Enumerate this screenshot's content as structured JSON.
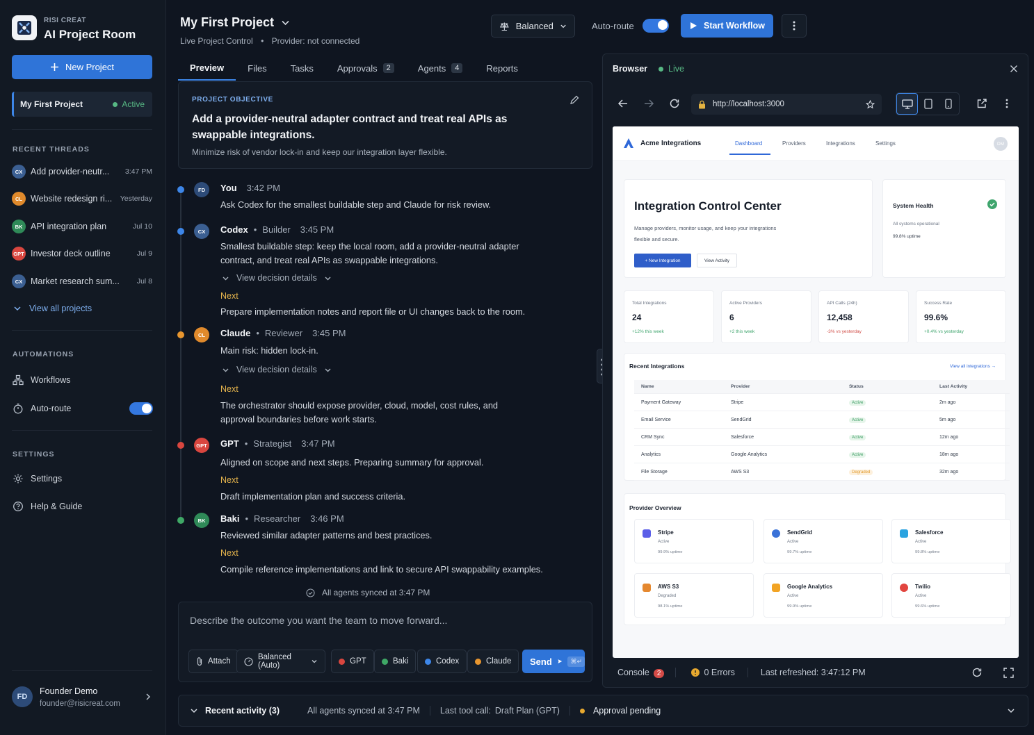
{
  "sidebar": {
    "brand_small": "RISI CREAT",
    "brand_title": "AI Project Room",
    "new_project_label": "New Project",
    "current_project": {
      "name": "My First Project",
      "status": "Active"
    },
    "recent_threads_heading": "RECENT THREADS",
    "threads": [
      {
        "avatar": "CX",
        "title": "Add provider-neutr...",
        "time": "3:47 PM",
        "color": "#3b5f92"
      },
      {
        "avatar": "CL",
        "title": "Website redesign ri...",
        "time": "Yesterday",
        "color": "#e08a2c"
      },
      {
        "avatar": "BK",
        "title": "API integration plan",
        "time": "Jul 10",
        "color": "#2f8a58"
      },
      {
        "avatar": "GPT",
        "title": "Investor deck outline",
        "time": "Jul 9",
        "color": "#d9463f"
      },
      {
        "avatar": "CX",
        "title": "Market research sum...",
        "time": "Jul 8",
        "color": "#3b5f92"
      }
    ],
    "view_all_label": "View all projects",
    "automations_heading": "AUTOMATIONS",
    "workflows_label": "Workflows",
    "auto_route_label": "Auto-route",
    "settings_heading": "SETTINGS",
    "settings_label": "Settings",
    "help_label": "Help & Guide",
    "user": {
      "initials": "FD",
      "name": "Founder Demo",
      "email": "founder@risicreat.com"
    }
  },
  "header": {
    "project_title": "My First Project",
    "subtitle": "Live Project Control",
    "provider_status": "Provider: not connected",
    "mode_label": "Balanced",
    "auto_route_label": "Auto-route",
    "start_label": "Start Workflow"
  },
  "tabs": [
    {
      "label": "Preview",
      "badge": ""
    },
    {
      "label": "Files",
      "badge": ""
    },
    {
      "label": "Tasks",
      "badge": ""
    },
    {
      "label": "Approvals",
      "badge": "2"
    },
    {
      "label": "Agents",
      "badge": "4"
    },
    {
      "label": "Reports",
      "badge": ""
    }
  ],
  "objective": {
    "heading": "PROJECT OBJECTIVE",
    "title": "Add a provider-neutral adapter contract and treat real APIs as swappable integrations.",
    "description": "Minimize risk of vendor lock-in and keep our integration layer flexible."
  },
  "messages": [
    {
      "avatar": "FD",
      "name": "You",
      "role": "",
      "time": "3:42 PM",
      "body": "Ask Codex for the smallest buildable step and Claude for risk review.",
      "dot": "#3d86e8",
      "avcolor": "#2d4b78"
    },
    {
      "avatar": "CX",
      "name": "Codex",
      "role": "Builder",
      "time": "3:45 PM",
      "body": "Smallest buildable step: keep the local room, add a provider-neutral adapter contract, and treat real APIs as swappable integrations.",
      "details": "View decision details",
      "next_label": "Next",
      "next": "Prepare implementation notes and report file or UI changes back to the room.",
      "dot": "#3d86e8",
      "avcolor": "#3b5f92"
    },
    {
      "avatar": "CL",
      "name": "Claude",
      "role": "Reviewer",
      "time": "3:45 PM",
      "body": "Main risk: hidden lock-in.",
      "details": "View decision details",
      "next_label": "Next",
      "next": "The orchestrator should expose provider, cloud, model, cost rules, and approval boundaries before work starts.",
      "dot": "#e8962f",
      "avcolor": "#e08a2c"
    },
    {
      "avatar": "GPT",
      "name": "GPT",
      "role": "Strategist",
      "time": "3:47 PM",
      "body": "Aligned on scope and next steps. Preparing summary for approval.",
      "next_label": "Next",
      "next": "Draft implementation plan and success criteria.",
      "dot": "#d9463f",
      "avcolor": "#d9463f"
    },
    {
      "avatar": "BK",
      "name": "Baki",
      "role": "Researcher",
      "time": "3:46 PM",
      "body": "Reviewed similar adapter patterns and best practices.",
      "next_label": "Next",
      "next": "Compile reference implementations and link to secure API swappability examples.",
      "dot": "#3fa866",
      "avcolor": "#2f8a58"
    }
  ],
  "synced_text": "All agents synced at 3:47 PM",
  "composer": {
    "placeholder": "Describe the outcome you want the team to move forward...",
    "attach": "Attach",
    "mode": "Balanced (Auto)",
    "agents": [
      {
        "label": "GPT",
        "color": "#d9463f"
      },
      {
        "label": "Baki",
        "color": "#3fa866"
      },
      {
        "label": "Codex",
        "color": "#3d86e8"
      },
      {
        "label": "Claude",
        "color": "#e8962f"
      }
    ],
    "send": "Send",
    "shortcut": "⌘↵"
  },
  "browser": {
    "title": "Browser",
    "status": "Live",
    "url": "http://localhost:3000",
    "console_label": "Console",
    "console_count": "2",
    "errors": "0 Errors",
    "refreshed": "Last refreshed: 3:47:12 PM"
  },
  "site": {
    "brand": "Acme Integrations",
    "nav": [
      "Dashboard",
      "Providers",
      "Integrations",
      "Settings"
    ],
    "avatar": "DM",
    "hero_title": "Integration Control Center",
    "hero_desc1": "Manage providers, monitor usage, and keep your integrations",
    "hero_desc2": "flexible and secure.",
    "new_integration": "+ New Integration",
    "view_activity": "View Activity",
    "health_title": "System Health",
    "health_status": "All systems operational",
    "health_uptime": "99.8% uptime",
    "stats": [
      {
        "label": "Total Integrations",
        "value": "24",
        "sub": "+12% this week",
        "neg": false
      },
      {
        "label": "Active Providers",
        "value": "6",
        "sub": "+2 this week",
        "neg": false
      },
      {
        "label": "API Calls (24h)",
        "value": "12,458",
        "sub": "-3% vs yesterday",
        "neg": true
      },
      {
        "label": "Success Rate",
        "value": "99.6%",
        "sub": "+0.4% vs yesterday",
        "neg": false
      }
    ],
    "recent_title": "Recent Integrations",
    "view_all": "View all integrations →",
    "columns": [
      "Name",
      "Provider",
      "Status",
      "Last Activity"
    ],
    "rows": [
      {
        "name": "Payment Gateway",
        "provider": "Stripe",
        "status": "Active",
        "last": "2m ago"
      },
      {
        "name": "Email Service",
        "provider": "SendGrid",
        "status": "Active",
        "last": "5m ago"
      },
      {
        "name": "CRM Sync",
        "provider": "Salesforce",
        "status": "Active",
        "last": "12m ago"
      },
      {
        "name": "Analytics",
        "provider": "Google Analytics",
        "status": "Active",
        "last": "18m ago"
      },
      {
        "name": "File Storage",
        "provider": "AWS S3",
        "status": "Degraded",
        "last": "32m ago"
      }
    ],
    "overview_title": "Provider Overview",
    "providers": [
      {
        "name": "Stripe",
        "status": "Active",
        "uptime": "99.9% uptime",
        "color": "#5b5fe8"
      },
      {
        "name": "SendGrid",
        "status": "Active",
        "uptime": "99.7% uptime",
        "color": "#3a72d8"
      },
      {
        "name": "Salesforce",
        "status": "Active",
        "uptime": "99.8% uptime",
        "color": "#2aa3e0"
      },
      {
        "name": "AWS S3",
        "status": "Degraded",
        "uptime": "98.1% uptime",
        "color": "#e5882f"
      },
      {
        "name": "Google Analytics",
        "status": "Active",
        "uptime": "99.9% uptime",
        "color": "#f2a424"
      },
      {
        "name": "Twilio",
        "status": "Active",
        "uptime": "99.6% uptime",
        "color": "#e2453f"
      }
    ]
  },
  "bottom_bar": {
    "recent_activity": "Recent activity (3)",
    "synced": "All agents synced at 3:47 PM",
    "last_tool_label": "Last tool call:",
    "last_tool": "Draft Plan (GPT)",
    "approval": "Approval pending"
  }
}
